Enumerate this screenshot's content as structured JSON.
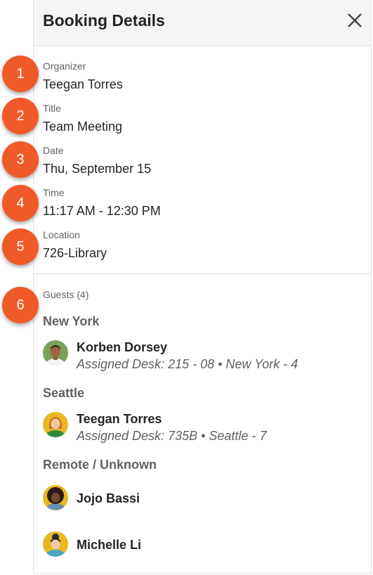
{
  "header": {
    "title": "Booking Details",
    "close_icon": "close-icon"
  },
  "fields": [
    {
      "label": "Organizer",
      "value": "Teegan Torres"
    },
    {
      "label": "Title",
      "value": "Team Meeting"
    },
    {
      "label": "Date",
      "value": "Thu, September 15"
    },
    {
      "label": "Time",
      "value": "11:17 AM - 12:30 PM"
    },
    {
      "label": "Location",
      "value": "726-Library"
    }
  ],
  "guests": {
    "heading": "Guests (4)",
    "groups": [
      {
        "name": "New York",
        "people": [
          {
            "name": "Korben Dorsey",
            "desk": "Assigned Desk: 215 - 08 • New York - 4"
          }
        ]
      },
      {
        "name": "Seattle",
        "people": [
          {
            "name": "Teegan Torres",
            "desk": "Assigned Desk: 735B • Seattle - 7"
          }
        ]
      },
      {
        "name": "Remote / Unknown",
        "people": [
          {
            "name": "Jojo Bassi"
          },
          {
            "name": "Michelle Li"
          }
        ]
      }
    ]
  },
  "badges": [
    "1",
    "2",
    "3",
    "4",
    "5",
    "6"
  ],
  "colors": {
    "badge": "#f05a28",
    "header_bg": "#f5f5f5",
    "text": "#252423",
    "muted": "#616161"
  }
}
